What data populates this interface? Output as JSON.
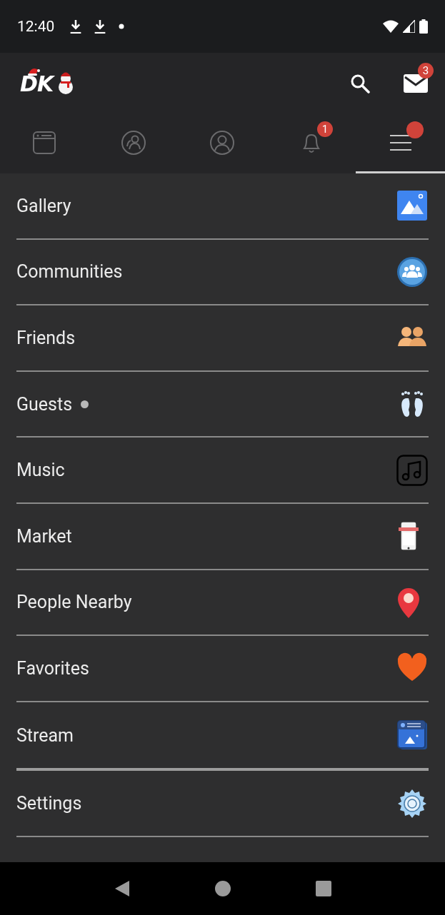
{
  "status_bar": {
    "time": "12:40"
  },
  "header": {
    "logo": "DK",
    "mail_badge": "3"
  },
  "tabs": [
    {
      "kind": "feed",
      "selected": false
    },
    {
      "kind": "communities",
      "selected": false
    },
    {
      "kind": "profile",
      "selected": false
    },
    {
      "kind": "notifications",
      "selected": false,
      "badge": "1"
    },
    {
      "kind": "menu",
      "selected": true,
      "dot": true
    }
  ],
  "menu": [
    {
      "items": [
        {
          "label": "Gallery",
          "kind": "photo",
          "new": false
        },
        {
          "label": "Communities",
          "kind": "group",
          "new": false
        },
        {
          "label": "Friends",
          "kind": "people",
          "new": false
        },
        {
          "label": "Guests",
          "kind": "feet",
          "new": true
        },
        {
          "label": "Music",
          "kind": "music",
          "new": false
        },
        {
          "label": "Market",
          "kind": "shop",
          "new": false
        },
        {
          "label": "People Nearby",
          "kind": "pin",
          "new": false
        },
        {
          "label": "Favorites",
          "kind": "heart",
          "new": false
        },
        {
          "label": "Stream",
          "kind": "stream",
          "new": false
        }
      ]
    },
    {
      "items": [
        {
          "label": "Settings",
          "kind": "gear",
          "new": false
        }
      ]
    }
  ]
}
